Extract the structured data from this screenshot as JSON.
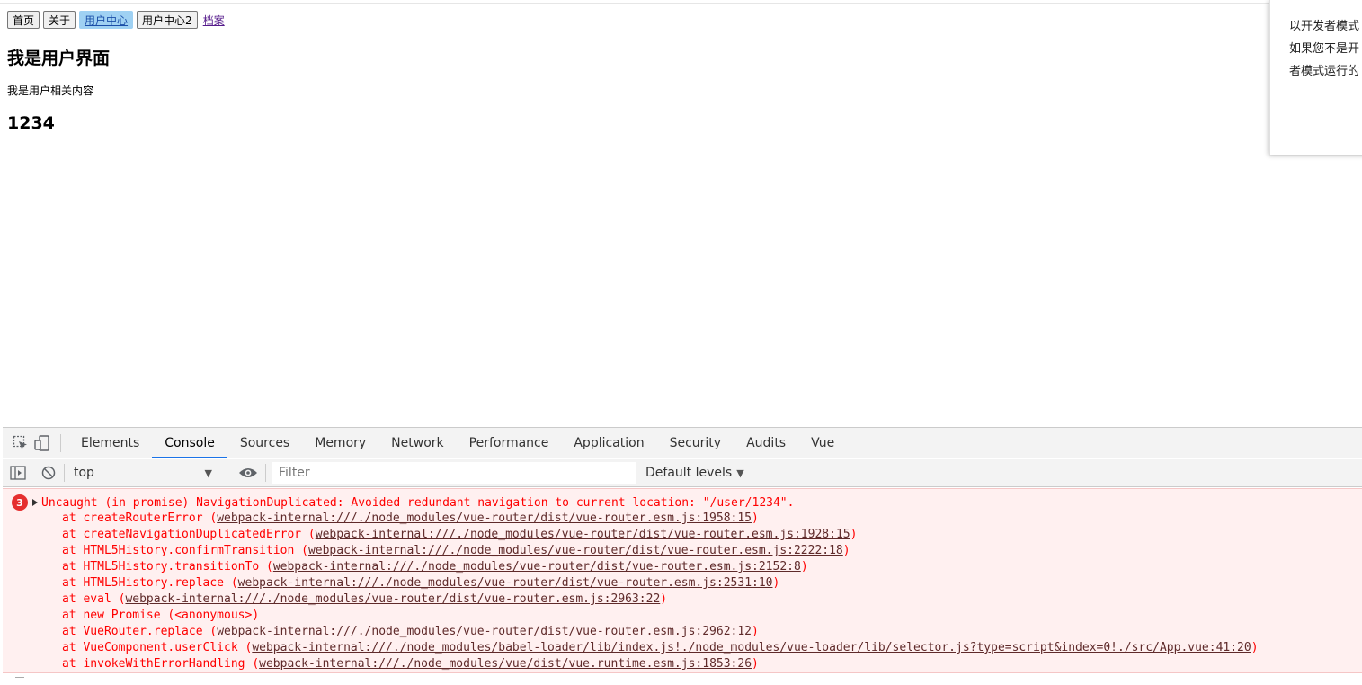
{
  "nav": {
    "home": "首页",
    "about": "关于",
    "user_center": "用户中心",
    "user_center2": "用户中心2",
    "profile_link": "档案"
  },
  "page": {
    "title": "我是用户界面",
    "content": "我是用户相关内容",
    "user_id": "1234"
  },
  "notice": {
    "line1": "以开发者模式",
    "line2": "如果您不是开",
    "line3": "者模式运行的"
  },
  "devtools": {
    "tabs": [
      "Elements",
      "Console",
      "Sources",
      "Memory",
      "Network",
      "Performance",
      "Application",
      "Security",
      "Audits",
      "Vue"
    ],
    "active_tab": "Console",
    "context": "top",
    "filter_placeholder": "Filter",
    "levels": "Default levels",
    "accent_color": "#1a73e8"
  },
  "console": {
    "error_count": "3",
    "error_message": "Uncaught (in promise) NavigationDuplicated: Avoided redundant navigation to current location: \"/user/1234\".",
    "error_color": "#ff0000",
    "stack": [
      {
        "prefix": "at createRouterError (",
        "link": "webpack-internal:///./node_modules/vue-router/dist/vue-router.esm.js:1958:15",
        "suffix": ")"
      },
      {
        "prefix": "at createNavigationDuplicatedError (",
        "link": "webpack-internal:///./node_modules/vue-router/dist/vue-router.esm.js:1928:15",
        "suffix": ")"
      },
      {
        "prefix": "at HTML5History.confirmTransition (",
        "link": "webpack-internal:///./node_modules/vue-router/dist/vue-router.esm.js:2222:18",
        "suffix": ")"
      },
      {
        "prefix": "at HTML5History.transitionTo (",
        "link": "webpack-internal:///./node_modules/vue-router/dist/vue-router.esm.js:2152:8",
        "suffix": ")"
      },
      {
        "prefix": "at HTML5History.replace (",
        "link": "webpack-internal:///./node_modules/vue-router/dist/vue-router.esm.js:2531:10",
        "suffix": ")"
      },
      {
        "prefix": "at eval (",
        "link": "webpack-internal:///./node_modules/vue-router/dist/vue-router.esm.js:2963:22",
        "suffix": ")"
      },
      {
        "prefix": "at new Promise (<anonymous>)",
        "link": "",
        "suffix": ""
      },
      {
        "prefix": "at VueRouter.replace (",
        "link": "webpack-internal:///./node_modules/vue-router/dist/vue-router.esm.js:2962:12",
        "suffix": ")"
      },
      {
        "prefix": "at VueComponent.userClick (",
        "link": "webpack-internal:///./node_modules/babel-loader/lib/index.js!./node_modules/vue-loader/lib/selector.js?type=script&index=0!./src/App.vue:41:20",
        "suffix": ")"
      },
      {
        "prefix": "at invokeWithErrorHandling (",
        "link": "webpack-internal:///./node_modules/vue/dist/vue.runtime.esm.js:1853:26",
        "suffix": ")"
      }
    ]
  }
}
